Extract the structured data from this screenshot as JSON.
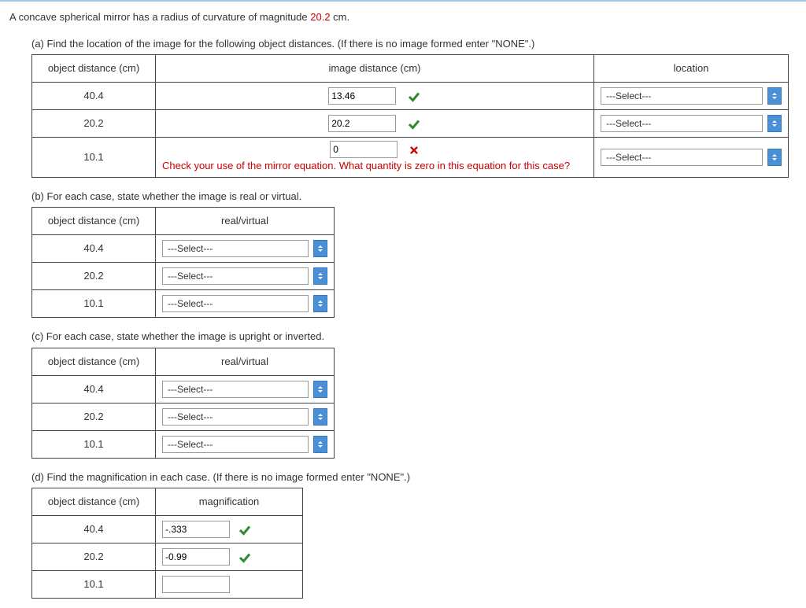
{
  "intro": {
    "prefix": "A concave spherical mirror has a radius of curvature of magnitude ",
    "radius": "20.2",
    "suffix": " cm."
  },
  "a": {
    "prompt": "(a) Find the location of the image for the following object distances. (If there is no image formed enter \"NONE\".)",
    "headers": {
      "obj": "object distance (cm)",
      "img": "image distance (cm)",
      "loc": "location"
    },
    "rows": [
      {
        "obj": "40.4",
        "value": "13.46",
        "ok": true,
        "loc": "---Select---"
      },
      {
        "obj": "20.2",
        "value": "20.2",
        "ok": true,
        "loc": "---Select---"
      },
      {
        "obj": "10.1",
        "value": "0",
        "ok": false,
        "loc": "---Select---",
        "feedback": "Check your use of the mirror equation. What quantity is zero in this equation for this case?"
      }
    ]
  },
  "b": {
    "prompt": "(b) For each case, state whether the image is real or virtual.",
    "headers": {
      "obj": "object distance (cm)",
      "sel": "real/virtual"
    },
    "rows": [
      {
        "obj": "40.4",
        "sel": "---Select---"
      },
      {
        "obj": "20.2",
        "sel": "---Select---"
      },
      {
        "obj": "10.1",
        "sel": "---Select---"
      }
    ]
  },
  "c": {
    "prompt": "(c) For each case, state whether the image is upright or inverted.",
    "headers": {
      "obj": "object distance (cm)",
      "sel": "real/virtual"
    },
    "rows": [
      {
        "obj": "40.4",
        "sel": "---Select---"
      },
      {
        "obj": "20.2",
        "sel": "---Select---"
      },
      {
        "obj": "10.1",
        "sel": "---Select---"
      }
    ]
  },
  "d": {
    "prompt": "(d) Find the magnification in each case. (If there is no image formed enter \"NONE\".)",
    "headers": {
      "obj": "object distance (cm)",
      "mag": "magnification"
    },
    "rows": [
      {
        "obj": "40.4",
        "value": "-.333",
        "ok": true
      },
      {
        "obj": "20.2",
        "value": "-0.99",
        "ok": true
      },
      {
        "obj": "10.1",
        "value": "",
        "ok": null
      }
    ]
  }
}
